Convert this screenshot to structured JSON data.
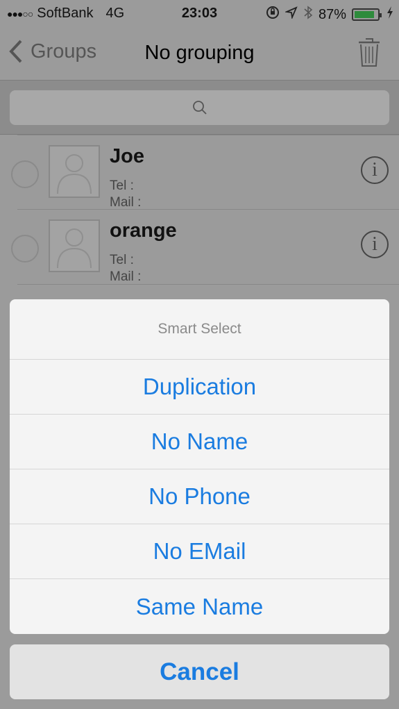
{
  "status_bar": {
    "signal_dots": "●●●○○",
    "carrier": "SoftBank",
    "network": "4G",
    "time": "23:03",
    "battery_percent": "87%",
    "battery_level": 0.87,
    "icons": [
      "rotation-lock-icon",
      "location-icon",
      "bluetooth-icon",
      "battery-icon",
      "charging-icon"
    ]
  },
  "navbar": {
    "back_label": "Groups",
    "title": "No grouping",
    "right_icon": "trash-icon"
  },
  "search": {
    "icon": "search-icon",
    "placeholder": ""
  },
  "contacts": [
    {
      "name": "Joe",
      "tel_label": "Tel :",
      "mail_label": "Mail :"
    },
    {
      "name": "orange",
      "tel_label": "Tel :",
      "mail_label": "Mail :"
    }
  ],
  "action_sheet": {
    "title": "Smart Select",
    "items": [
      "Duplication",
      "No Name",
      "No Phone",
      "No EMail",
      "Same Name"
    ],
    "cancel_label": "Cancel",
    "accent_color": "#1a7ce0"
  }
}
